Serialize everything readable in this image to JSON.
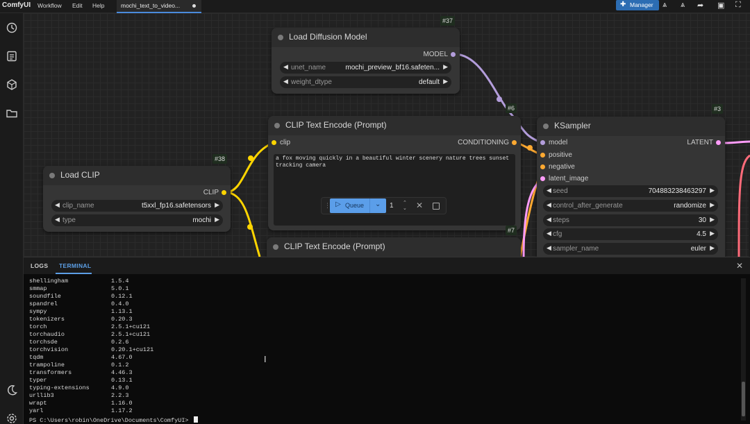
{
  "app": {
    "name": "ComfyUI",
    "menu": [
      "Workflow",
      "Edit",
      "Help"
    ],
    "tab_title": "mochi_text_to_video...",
    "manager_label": "Manager"
  },
  "nodes": {
    "load_diffusion": {
      "id": "#37",
      "title": "Load Diffusion Model",
      "output": "MODEL",
      "widgets": [
        {
          "label": "unet_name",
          "value": "mochi_preview_bf16.safeten..."
        },
        {
          "label": "weight_dtype",
          "value": "default"
        }
      ]
    },
    "clip_text_pos": {
      "id": "#6",
      "title": "CLIP Text Encode (Prompt)",
      "input": "clip",
      "output": "CONDITIONING",
      "text": "a fox moving quickly in a beautiful winter scenery nature trees sunset tracking camera"
    },
    "clip_text_neg": {
      "id": "#7",
      "title": "CLIP Text Encode (Prompt)"
    },
    "load_clip": {
      "id": "#38",
      "title": "Load CLIP",
      "output": "CLIP",
      "widgets": [
        {
          "label": "clip_name",
          "value": "t5xxl_fp16.safetensors"
        },
        {
          "label": "type",
          "value": "mochi"
        }
      ]
    },
    "ksampler": {
      "id": "#3",
      "title": "KSampler",
      "inputs": [
        "model",
        "positive",
        "negative",
        "latent_image"
      ],
      "output": "LATENT",
      "widgets": [
        {
          "label": "seed",
          "value": "704883238463297"
        },
        {
          "label": "control_after_generate",
          "value": "randomize"
        },
        {
          "label": "steps",
          "value": "30"
        },
        {
          "label": "cfg",
          "value": "4.5"
        },
        {
          "label": "sampler_name",
          "value": "euler"
        }
      ]
    }
  },
  "queue": {
    "label": "Queue",
    "count": "1"
  },
  "panel": {
    "tabs": [
      "LOGS",
      "TERMINAL"
    ],
    "active_tab": "TERMINAL"
  },
  "terminal": {
    "packages": [
      {
        "name": "shellingham",
        "version": "1.5.4"
      },
      {
        "name": "smmap",
        "version": "5.0.1"
      },
      {
        "name": "soundfile",
        "version": "0.12.1"
      },
      {
        "name": "spandrel",
        "version": "0.4.0"
      },
      {
        "name": "sympy",
        "version": "1.13.1"
      },
      {
        "name": "tokenizers",
        "version": "0.20.3"
      },
      {
        "name": "torch",
        "version": "2.5.1+cu121"
      },
      {
        "name": "torchaudio",
        "version": "2.5.1+cu121"
      },
      {
        "name": "torchsde",
        "version": "0.2.6"
      },
      {
        "name": "torchvision",
        "version": "0.20.1+cu121"
      },
      {
        "name": "tqdm",
        "version": "4.67.0"
      },
      {
        "name": "trampoline",
        "version": "0.1.2"
      },
      {
        "name": "transformers",
        "version": "4.46.3"
      },
      {
        "name": "typer",
        "version": "0.13.1"
      },
      {
        "name": "typing-extensions",
        "version": "4.9.0"
      },
      {
        "name": "urllib3",
        "version": "2.2.3"
      },
      {
        "name": "wrapt",
        "version": "1.16.0"
      },
      {
        "name": "yarl",
        "version": "1.17.2"
      }
    ],
    "prompt": "PS C:\\Users\\robin\\OneDrive\\Documents\\ComfyUI> "
  },
  "colors": {
    "accent": "#5c9fe6",
    "clip_wire": "#ffd500",
    "model_wire": "#b39ddb",
    "conditioning_wire": "#ffa931",
    "latent_wire": "#ff9cf9"
  }
}
